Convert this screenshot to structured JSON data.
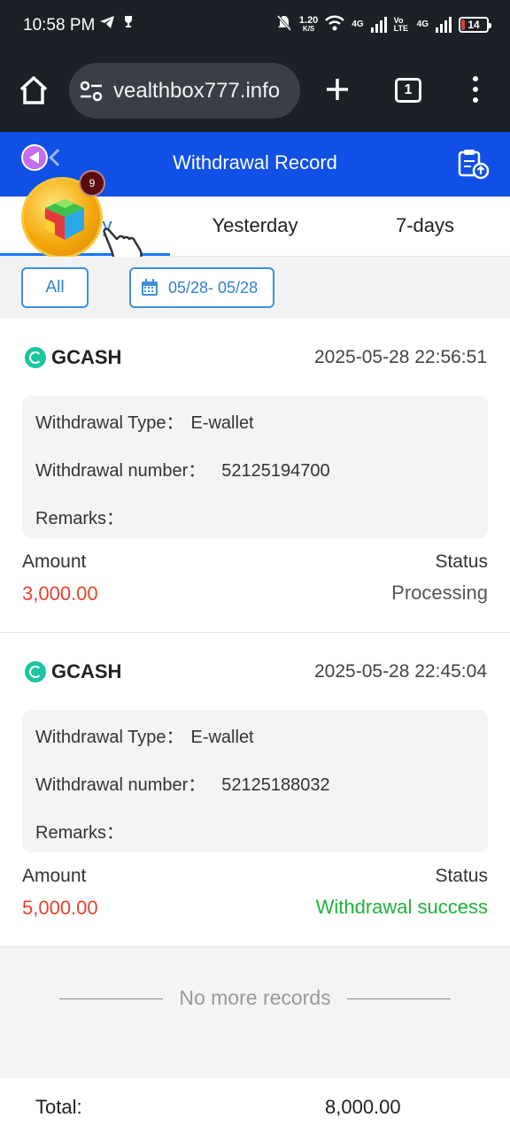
{
  "statusbar": {
    "time": "10:58 PM",
    "net_speed_value": "1.20",
    "net_speed_unit": "K/S",
    "net1": "4G",
    "volte": "Vo LTE",
    "net2": "4G",
    "battery": "14"
  },
  "browser": {
    "url": "vealthbox777.info",
    "tab_count": "1"
  },
  "header": {
    "title": "Withdrawal Record"
  },
  "floating": {
    "badge_count": "9"
  },
  "tabs": [
    {
      "label": "y"
    },
    {
      "label": "Yesterday"
    },
    {
      "label": "7-days"
    }
  ],
  "filters": {
    "all_label": "All",
    "date_range": "05/28- 05/28"
  },
  "records": [
    {
      "method": "GCASH",
      "datetime": "2025-05-28 22:56:51",
      "type_label": "Withdrawal Type：",
      "type_value": "E-wallet",
      "number_label": "Withdrawal number：",
      "number_value": "52125194700",
      "remarks_label": "Remarks：",
      "remarks_value": "",
      "amount_label": "Amount",
      "amount": "3,000.00",
      "status_label": "Status",
      "status": "Processing"
    },
    {
      "method": "GCASH",
      "datetime": "2025-05-28 22:45:04",
      "type_label": "Withdrawal Type：",
      "type_value": "E-wallet",
      "number_label": "Withdrawal number：",
      "number_value": "52125188032",
      "remarks_label": "Remarks：",
      "remarks_value": "",
      "amount_label": "Amount",
      "amount": "5,000.00",
      "status_label": "Status",
      "status": "Withdrawal success"
    }
  ],
  "footer": {
    "no_more": "No more records",
    "total_label": "Total:",
    "total_value": "8,000.00"
  },
  "colors": {
    "header_blue": "#1150e6",
    "active_tab": "#1677ff",
    "amount_red": "#e6432e",
    "success_green": "#21b339"
  }
}
